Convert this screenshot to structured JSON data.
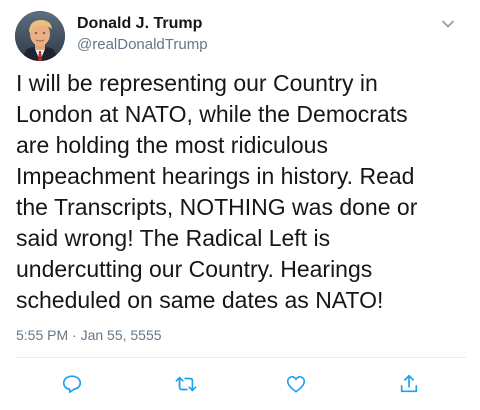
{
  "author": {
    "display_name": "Donald J. Trump",
    "handle": "@realDonaldTrump",
    "avatar_icon": "profile-photo"
  },
  "menu": {
    "icon": "chevron-down-icon"
  },
  "tweet": {
    "text": "I will be representing our Country in\nLondon at NATO, while the Democrats\nare holding the most ridiculous\nImpeachment hearings in history. Read\nthe Transcripts, NOTHING was done or\nsaid wrong! The Radical Left is\nundercutting our Country. Hearings\nscheduled on same dates as NATO!",
    "timestamp": "5:55 PM · Jan 55, 5555"
  },
  "actions": [
    {
      "name": "reply",
      "icon": "reply-icon"
    },
    {
      "name": "retweet",
      "icon": "retweet-icon"
    },
    {
      "name": "like",
      "icon": "like-icon"
    },
    {
      "name": "share",
      "icon": "share-icon"
    }
  ],
  "colors": {
    "text": "#14171a",
    "secondary": "#657786",
    "icon": "#1da1f2",
    "divider": "#e6ecf0"
  }
}
